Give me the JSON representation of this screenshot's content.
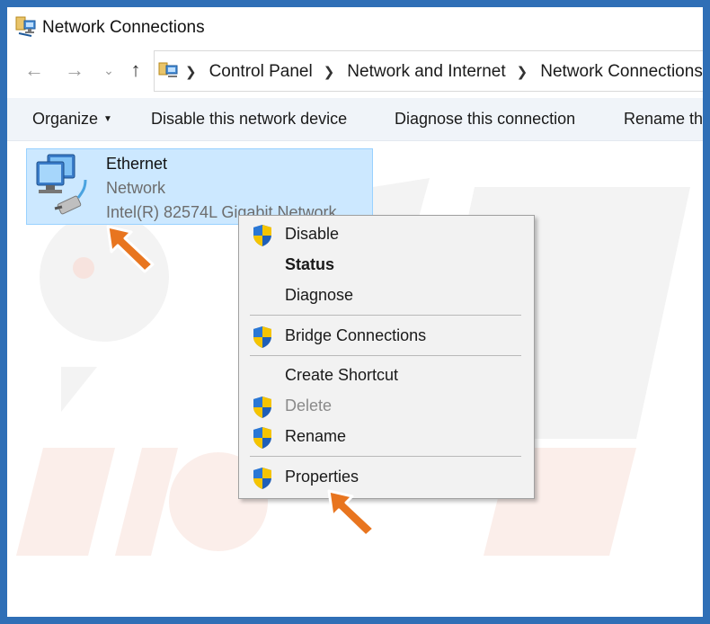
{
  "window": {
    "title": "Network Connections"
  },
  "address_bar": {
    "crumbs": [
      "Control Panel",
      "Network and Internet",
      "Network Connections"
    ]
  },
  "command_bar": {
    "organize": "Organize",
    "disable": "Disable this network device",
    "diagnose": "Diagnose this connection",
    "rename": "Rename th"
  },
  "connection": {
    "name": "Ethernet",
    "network": "Network",
    "device": "Intel(R) 82574L Gigabit Network ..."
  },
  "context_menu": {
    "items": [
      {
        "label": "Disable",
        "shield": true
      },
      {
        "label": "Status",
        "bold": true
      },
      {
        "label": "Diagnose"
      },
      {
        "label": "Bridge Connections",
        "shield": true
      },
      {
        "label": "Create Shortcut"
      },
      {
        "label": "Delete",
        "shield": true,
        "disabled": true
      },
      {
        "label": "Rename",
        "shield": true
      },
      {
        "label": "Properties",
        "shield": true
      }
    ]
  },
  "colors": {
    "frame": "#2f6fb6",
    "selection": "#cce8ff",
    "selection_border": "#99d1ff",
    "highlight_arrow": "#e8751f"
  },
  "icons": {
    "back": "arrow-left-icon",
    "forward": "arrow-right-icon",
    "up": "arrow-up-icon",
    "recent": "chevron-down-icon",
    "shield": "uac-shield-icon"
  }
}
